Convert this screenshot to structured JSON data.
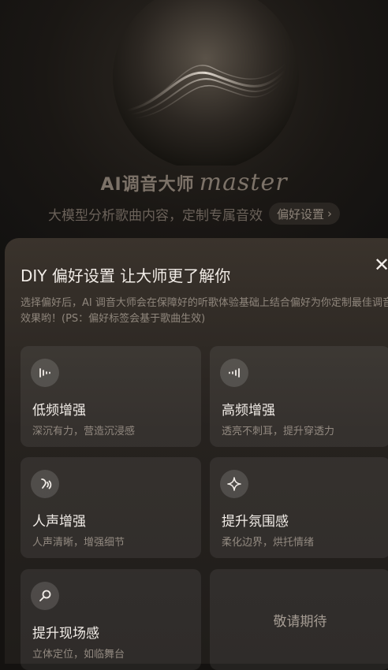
{
  "header": {
    "brand_cn": "AI调音大师",
    "brand_script": "master",
    "subtitle": "大模型分析歌曲内容，定制专属音效",
    "pref_button": "偏好设置",
    "pref_chevron": "›"
  },
  "sheet": {
    "title": "DIY 偏好设置 让大师更了解你",
    "close": "✕",
    "description": "选择偏好后，AI 调音大师会在保障好的听歌体验基础上结合偏好为你定制最佳调音效果哟！(PS：偏好标签会基于歌曲生效)",
    "cards": [
      {
        "icon": "bass-wave-icon",
        "title": "低频增强",
        "subtitle": "深沉有力，营造沉浸感"
      },
      {
        "icon": "treble-wave-icon",
        "title": "高频增强",
        "subtitle": "透亮不刺耳，提升穿透力"
      },
      {
        "icon": "voice-icon",
        "title": "人声增强",
        "subtitle": "人声清晰，增强细节"
      },
      {
        "icon": "sparkle-icon",
        "title": "提升氛围感",
        "subtitle": "柔化边界，烘托情绪"
      },
      {
        "icon": "microphone-icon",
        "title": "提升现场感",
        "subtitle": "立体定位，如临舞台"
      },
      {
        "title": "敬请期待"
      }
    ]
  }
}
